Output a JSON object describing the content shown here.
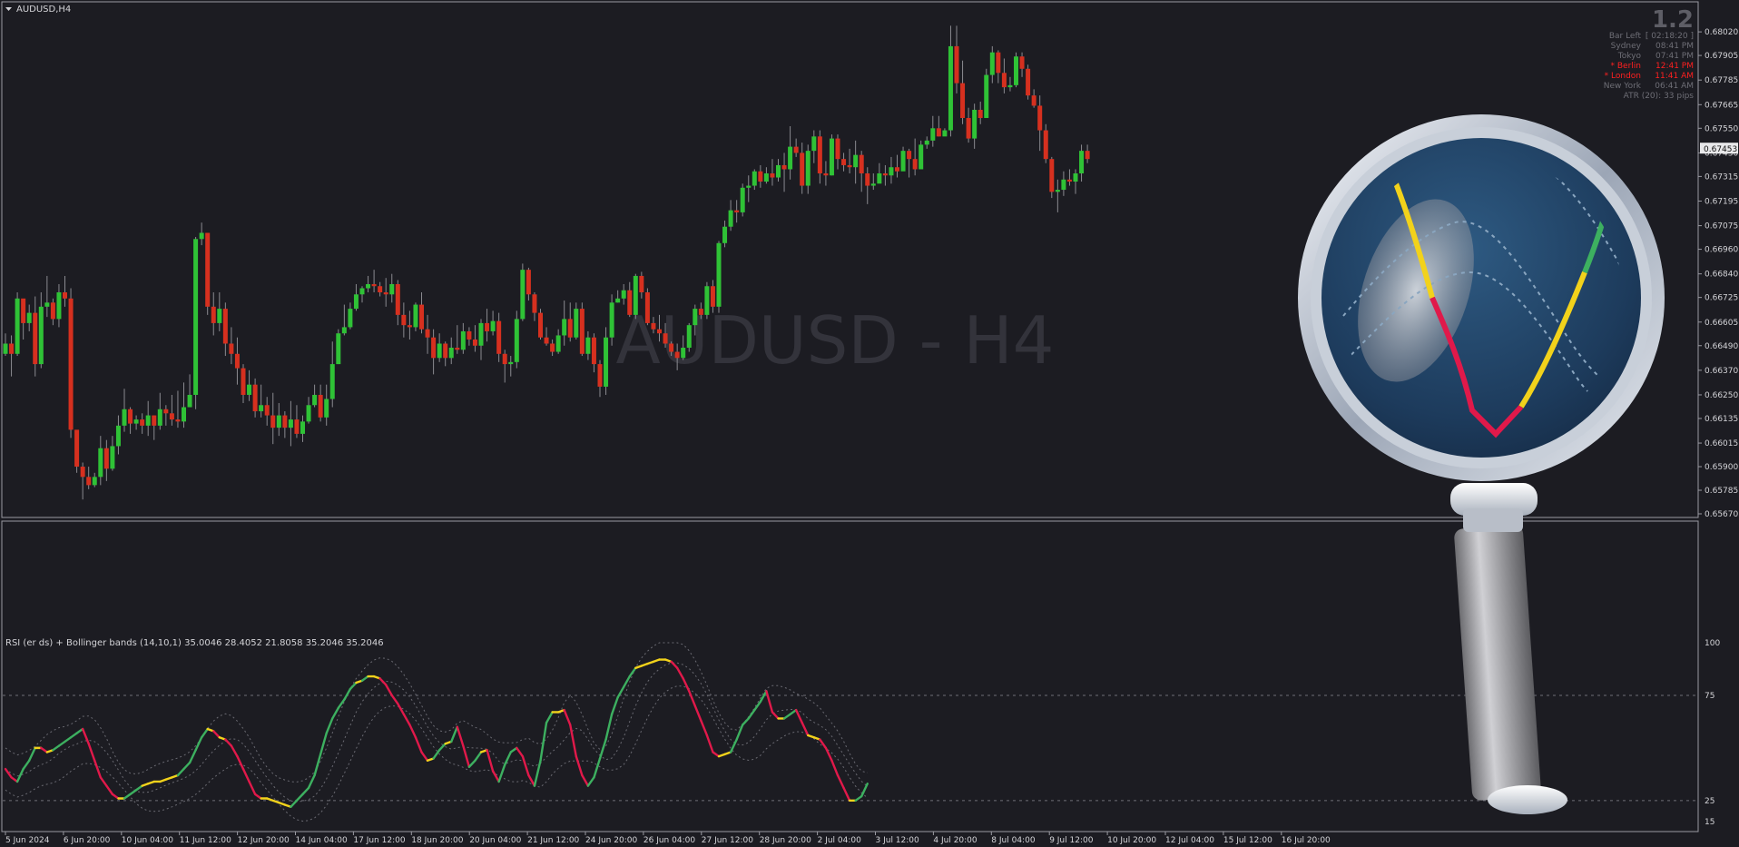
{
  "window": {
    "title": "AUDUSD,H4",
    "watermark": "AUDUSD - H4",
    "version_label": "1.2"
  },
  "info_panel": [
    {
      "label": "Bar Left",
      "value": "[ 02:18:20 ]",
      "highlight": false
    },
    {
      "label": "Sydney",
      "value": "08:41 PM",
      "highlight": false
    },
    {
      "label": "Tokyo",
      "value": "07:41 PM",
      "highlight": false
    },
    {
      "label": "* Berlin",
      "value": "12:41 PM",
      "highlight": true
    },
    {
      "label": "* London",
      "value": "11:41 AM",
      "highlight": true
    },
    {
      "label": "New York",
      "value": "06:41 AM",
      "highlight": false
    },
    {
      "label": "ATR (20): 33 pips",
      "value": "",
      "highlight": false
    }
  ],
  "colors": {
    "background": "#1c1c22",
    "bull": "#2fc236",
    "bear": "#d6301f",
    "rsi_up": "#3db060",
    "rsi_flat": "#f2d21b",
    "rsi_down": "#e0194a",
    "grid": "#6e6e76",
    "frame": "#9a9aa2",
    "text": "#d4d4d8",
    "highlight": "#ff2020"
  },
  "icons": {
    "menu": "triangle-down-icon",
    "magnifier": "magnifying-glass-icon"
  },
  "chart_data": [
    {
      "type": "candlestick",
      "title": "AUDUSD,H4",
      "price_axis_ticks": [
        "0.68020",
        "0.67905",
        "0.67785",
        "0.67665",
        "0.67550",
        "0.67430",
        "0.67315",
        "0.67195",
        "0.67075",
        "0.66960",
        "0.66840",
        "0.66725",
        "0.66605",
        "0.66490",
        "0.66370",
        "0.66250",
        "0.66135",
        "0.66015",
        "0.65900",
        "0.65785",
        "0.65670"
      ],
      "current_price": "0.67453",
      "ylim": [
        0.6567,
        0.6814
      ],
      "time_axis_ticks": [
        "5 Jun 2024",
        "6 Jun 20:00",
        "10 Jun 04:00",
        "11 Jun 12:00",
        "12 Jun 20:00",
        "14 Jun 04:00",
        "17 Jun 12:00",
        "18 Jun 20:00",
        "20 Jun 04:00",
        "21 Jun 12:00",
        "24 Jun 20:00",
        "26 Jun 04:00",
        "27 Jun 12:00",
        "28 Jun 20:00",
        "2 Jul 04:00",
        "3 Jul 12:00",
        "4 Jul 20:00",
        "8 Jul 04:00",
        "9 Jul 12:00",
        "10 Jul 20:00",
        "12 Jul 04:00",
        "15 Jul 12:00",
        "16 Jul 20:00"
      ],
      "closes": [
        0.665,
        0.6645,
        0.6672,
        0.666,
        0.6665,
        0.664,
        0.6668,
        0.667,
        0.6662,
        0.6675,
        0.6672,
        0.6608,
        0.659,
        0.6585,
        0.6581,
        0.6585,
        0.6599,
        0.6589,
        0.66,
        0.661,
        0.6618,
        0.6611,
        0.6613,
        0.661,
        0.6615,
        0.661,
        0.6618,
        0.6616,
        0.6613,
        0.6612,
        0.6619,
        0.6625,
        0.6701,
        0.6704,
        0.6668,
        0.666,
        0.6667,
        0.665,
        0.6645,
        0.6638,
        0.6625,
        0.663,
        0.6617,
        0.662,
        0.6615,
        0.6609,
        0.6615,
        0.6609,
        0.6613,
        0.6606,
        0.6612,
        0.662,
        0.6625,
        0.6614,
        0.6623,
        0.664,
        0.6655,
        0.6658,
        0.6667,
        0.6674,
        0.6677,
        0.6679,
        0.6678,
        0.6675,
        0.6674,
        0.6679,
        0.6664,
        0.6659,
        0.6658,
        0.6669,
        0.6657,
        0.6653,
        0.6643,
        0.665,
        0.6643,
        0.6648,
        0.6647,
        0.6656,
        0.6652,
        0.6649,
        0.666,
        0.6656,
        0.6661,
        0.6645,
        0.664,
        0.6641,
        0.6662,
        0.6686,
        0.6674,
        0.6665,
        0.6653,
        0.665,
        0.6646,
        0.6654,
        0.6662,
        0.6653,
        0.6667,
        0.6645,
        0.6653,
        0.664,
        0.6629,
        0.6653,
        0.667,
        0.6672,
        0.6676,
        0.6664,
        0.6683,
        0.6675,
        0.666,
        0.6657,
        0.6655,
        0.665,
        0.6646,
        0.6643,
        0.6648,
        0.6659,
        0.6667,
        0.6664,
        0.6678,
        0.6668,
        0.6699,
        0.6707,
        0.6715,
        0.6714,
        0.6726,
        0.6727,
        0.6734,
        0.6729,
        0.6733,
        0.6731,
        0.6737,
        0.6735,
        0.6746,
        0.6743,
        0.6727,
        0.6744,
        0.6751,
        0.6733,
        0.6732,
        0.675,
        0.674,
        0.6737,
        0.6736,
        0.6742,
        0.6733,
        0.6727,
        0.6728,
        0.6733,
        0.6732,
        0.6736,
        0.6734,
        0.6744,
        0.674,
        0.6735,
        0.6747,
        0.6749,
        0.6755,
        0.6751,
        0.6754,
        0.6795,
        0.6777,
        0.676,
        0.675,
        0.6764,
        0.676,
        0.6781,
        0.6792,
        0.6782,
        0.6775,
        0.6776,
        0.679,
        0.6784,
        0.6771,
        0.6766,
        0.6754,
        0.674,
        0.6724,
        0.6725,
        0.673,
        0.6729,
        0.6733,
        0.6744,
        0.674
      ],
      "highs": [
        0.6655,
        0.6654,
        0.6675,
        0.6667,
        0.6669,
        0.6673,
        0.6675,
        0.6683,
        0.6672,
        0.6679,
        0.6683,
        0.6677,
        0.6597,
        0.6592,
        0.659,
        0.6587,
        0.6605,
        0.6603,
        0.6605,
        0.6615,
        0.6628,
        0.6619,
        0.6615,
        0.6616,
        0.6622,
        0.6615,
        0.6626,
        0.662,
        0.6625,
        0.6627,
        0.6631,
        0.6635,
        0.6702,
        0.6709,
        0.6704,
        0.6675,
        0.6675,
        0.667,
        0.6658,
        0.6653,
        0.664,
        0.6637,
        0.6633,
        0.663,
        0.6624,
        0.6626,
        0.6621,
        0.6617,
        0.6622,
        0.662,
        0.6615,
        0.6624,
        0.663,
        0.663,
        0.663,
        0.6651,
        0.6657,
        0.6669,
        0.667,
        0.6679,
        0.6678,
        0.6683,
        0.6686,
        0.668,
        0.6682,
        0.6684,
        0.6681,
        0.667,
        0.6666,
        0.667,
        0.6675,
        0.6664,
        0.6657,
        0.6655,
        0.6651,
        0.6653,
        0.6659,
        0.666,
        0.6658,
        0.6659,
        0.6662,
        0.6667,
        0.6666,
        0.6665,
        0.6647,
        0.6644,
        0.6666,
        0.6689,
        0.6687,
        0.6675,
        0.6667,
        0.6658,
        0.6652,
        0.6657,
        0.6671,
        0.667,
        0.667,
        0.667,
        0.6656,
        0.6655,
        0.6642,
        0.6658,
        0.6674,
        0.6676,
        0.6679,
        0.668,
        0.6684,
        0.6685,
        0.6677,
        0.6663,
        0.6664,
        0.666,
        0.6651,
        0.665,
        0.6654,
        0.666,
        0.6669,
        0.667,
        0.668,
        0.6681,
        0.67,
        0.671,
        0.672,
        0.672,
        0.6728,
        0.6732,
        0.6735,
        0.6737,
        0.6736,
        0.674,
        0.674,
        0.6743,
        0.6756,
        0.675,
        0.6748,
        0.6747,
        0.6754,
        0.6754,
        0.6739,
        0.6752,
        0.6752,
        0.6743,
        0.6745,
        0.6749,
        0.6744,
        0.6736,
        0.6733,
        0.6738,
        0.6737,
        0.6741,
        0.6742,
        0.6746,
        0.6745,
        0.675,
        0.6749,
        0.6751,
        0.6761,
        0.6761,
        0.6755,
        0.6805,
        0.6805,
        0.6788,
        0.6765,
        0.6767,
        0.6768,
        0.6784,
        0.6795,
        0.6793,
        0.6789,
        0.678,
        0.6792,
        0.6792,
        0.6786,
        0.6774,
        0.6771,
        0.6757,
        0.6741,
        0.673,
        0.6734,
        0.6735,
        0.6735,
        0.6747,
        0.6747
      ],
      "lows": [
        0.6644,
        0.6634,
        0.6644,
        0.6652,
        0.6656,
        0.6634,
        0.6638,
        0.6663,
        0.6659,
        0.6658,
        0.6668,
        0.6604,
        0.6587,
        0.6574,
        0.6579,
        0.658,
        0.6581,
        0.6583,
        0.6588,
        0.6596,
        0.6607,
        0.6606,
        0.6608,
        0.6606,
        0.6605,
        0.6603,
        0.6608,
        0.661,
        0.661,
        0.6609,
        0.6609,
        0.6619,
        0.6618,
        0.6698,
        0.6664,
        0.6654,
        0.6656,
        0.6644,
        0.664,
        0.663,
        0.6621,
        0.6622,
        0.6614,
        0.6614,
        0.661,
        0.6601,
        0.6605,
        0.6604,
        0.66,
        0.6604,
        0.6602,
        0.6611,
        0.6619,
        0.6612,
        0.661,
        0.6619,
        0.664,
        0.6654,
        0.6657,
        0.6666,
        0.667,
        0.6675,
        0.6675,
        0.6673,
        0.6668,
        0.667,
        0.6659,
        0.6653,
        0.6652,
        0.6656,
        0.6655,
        0.6645,
        0.6635,
        0.6641,
        0.6639,
        0.664,
        0.6645,
        0.6645,
        0.6649,
        0.6646,
        0.6642,
        0.6651,
        0.6654,
        0.6641,
        0.6631,
        0.6634,
        0.6638,
        0.6661,
        0.6671,
        0.6661,
        0.6652,
        0.6649,
        0.6644,
        0.6645,
        0.6649,
        0.6651,
        0.6652,
        0.6644,
        0.6642,
        0.6636,
        0.6624,
        0.6625,
        0.6649,
        0.667,
        0.6669,
        0.6663,
        0.6662,
        0.6672,
        0.6659,
        0.6655,
        0.6651,
        0.6648,
        0.6644,
        0.6637,
        0.6642,
        0.6646,
        0.6654,
        0.6662,
        0.6662,
        0.6665,
        0.6665,
        0.6697,
        0.6705,
        0.6709,
        0.6712,
        0.6719,
        0.6725,
        0.6726,
        0.6728,
        0.6727,
        0.6729,
        0.6724,
        0.673,
        0.6741,
        0.6723,
        0.6723,
        0.6738,
        0.6728,
        0.6727,
        0.6732,
        0.6735,
        0.6734,
        0.6733,
        0.6728,
        0.6724,
        0.6718,
        0.6725,
        0.6729,
        0.6727,
        0.6728,
        0.6731,
        0.6735,
        0.6731,
        0.6732,
        0.6744,
        0.6745,
        0.6746,
        0.6751,
        0.6752,
        0.6751,
        0.6772,
        0.6757,
        0.6748,
        0.6745,
        0.6757,
        0.676,
        0.6777,
        0.6777,
        0.6772,
        0.6773,
        0.6775,
        0.678,
        0.6769,
        0.6765,
        0.6744,
        0.6738,
        0.6721,
        0.6714,
        0.6722,
        0.6727,
        0.6723,
        0.6729,
        0.6738
      ]
    },
    {
      "type": "line",
      "title": "RSI (er ds) + Bollinger bands (14,10,1) 35.0046 28.4052 21.8058 35.2046 35.2046",
      "ylim": [
        15,
        100
      ],
      "level_ticks": [
        "100",
        "75",
        "25",
        "15"
      ],
      "levels": [
        75,
        25
      ],
      "series": [
        {
          "values": [
            40,
            36,
            34,
            40,
            44,
            50,
            50,
            48,
            49,
            51,
            53,
            55,
            57,
            59,
            52,
            44,
            36,
            32,
            28,
            26,
            26,
            28,
            30,
            32,
            33,
            34,
            34,
            35,
            36,
            37,
            40,
            43,
            49,
            55,
            59,
            58,
            55,
            54,
            51,
            46,
            40,
            34,
            28,
            26,
            26,
            25,
            24,
            23,
            22,
            25,
            28,
            31,
            37,
            47,
            57,
            64,
            69,
            73,
            78,
            81,
            82,
            84,
            84,
            83,
            80,
            75,
            71,
            66,
            61,
            55,
            48,
            44,
            45,
            49,
            52,
            53,
            60,
            51,
            41,
            44,
            48,
            49,
            39,
            34,
            42,
            48,
            50,
            46,
            37,
            32,
            44,
            62,
            67,
            67,
            68,
            61,
            46,
            37,
            32,
            36,
            45,
            54,
            66,
            74,
            79,
            84,
            88,
            89,
            90,
            91,
            92,
            92,
            91,
            88,
            83,
            77,
            70,
            63,
            56,
            48,
            46,
            47,
            48,
            54,
            61,
            64,
            68,
            72,
            77,
            67,
            64,
            64,
            66,
            68,
            62,
            56,
            55,
            54,
            50,
            44,
            37,
            31,
            25,
            25,
            27,
            33
          ]
        }
      ]
    }
  ]
}
